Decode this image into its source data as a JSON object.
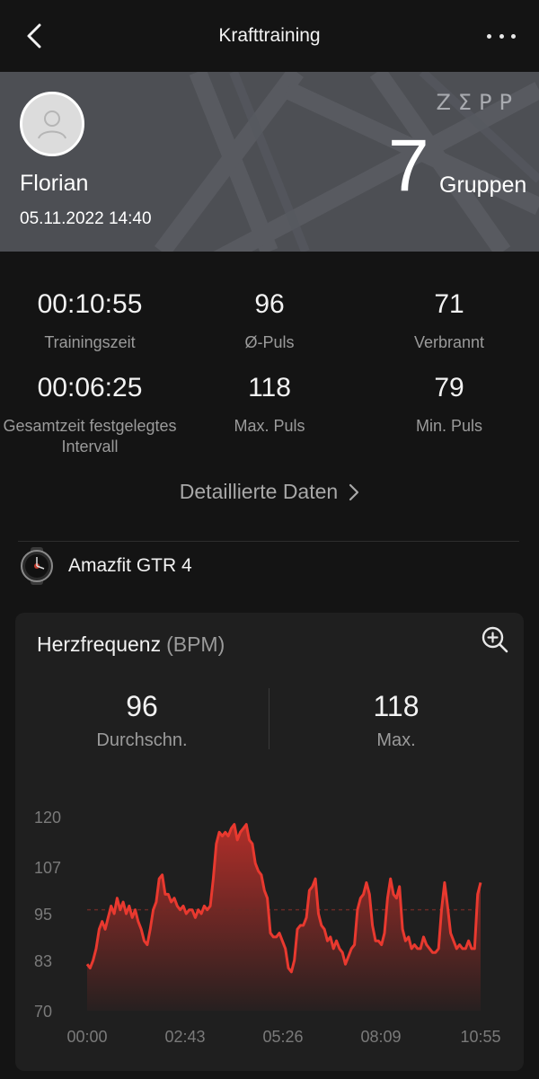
{
  "header": {
    "title": "Krafttraining"
  },
  "profile": {
    "name": "Florian",
    "datetime": "05.11.2022 14:40",
    "brand": "ZΣPP",
    "groups_count": "7",
    "groups_label": "Gruppen"
  },
  "stats": [
    {
      "value": "00:10:55",
      "label": "Trainingszeit"
    },
    {
      "value": "96",
      "label": "Ø-Puls"
    },
    {
      "value": "71",
      "label": "Verbrannt"
    },
    {
      "value": "00:06:25",
      "label": "Gesamtzeit festgelegtes Intervall"
    },
    {
      "value": "118",
      "label": "Max. Puls"
    },
    {
      "value": "79",
      "label": "Min. Puls"
    }
  ],
  "details_link": "Detaillierte Daten",
  "device": {
    "name": "Amazfit GTR 4"
  },
  "heart_card": {
    "title": "Herzfrequenz",
    "unit": "(BPM)",
    "avg_value": "96",
    "avg_label": "Durchschn.",
    "max_value": "118",
    "max_label": "Max."
  },
  "chart_data": {
    "type": "area",
    "title": "Herzfrequenz (BPM)",
    "xlabel": "",
    "ylabel": "",
    "x_ticks": [
      "00:00",
      "02:43",
      "05:26",
      "08:09",
      "10:55"
    ],
    "y_ticks": [
      120,
      107,
      95,
      83,
      70
    ],
    "ylim": [
      70,
      120
    ],
    "xlim_seconds": [
      0,
      655
    ],
    "avg_line": 96,
    "grid": false,
    "color": "#e8392f",
    "series": [
      {
        "x": [
          0,
          5,
          10,
          15,
          20,
          25,
          30,
          35,
          40,
          45,
          50,
          55,
          60,
          65,
          70,
          75,
          80,
          85,
          90,
          95,
          100,
          105,
          110,
          115,
          120,
          125,
          130,
          135,
          140,
          145,
          150,
          155,
          160,
          165,
          170,
          175,
          180,
          185,
          190,
          195,
          200,
          205,
          210,
          215,
          220,
          225,
          230,
          235,
          240,
          245,
          250,
          255,
          260,
          265,
          270,
          275,
          280,
          285,
          290,
          295,
          300,
          305,
          310,
          315,
          320,
          325,
          330,
          335,
          340,
          345,
          350,
          355,
          360,
          365,
          370,
          375,
          380,
          385,
          390,
          395,
          400,
          405,
          410,
          415,
          420,
          425,
          430,
          435,
          440,
          445,
          450,
          455,
          460,
          465,
          470,
          475,
          480,
          485,
          490,
          495,
          500,
          505,
          510,
          515,
          520,
          525,
          530,
          535,
          540,
          545,
          550,
          555,
          560,
          565,
          570,
          575,
          580,
          585,
          590,
          595,
          600,
          605,
          610,
          615,
          620,
          625,
          630,
          635,
          640,
          645,
          650,
          655
        ],
        "values": [
          82,
          81,
          83,
          86,
          91,
          93,
          91,
          94,
          97,
          95,
          99,
          96,
          98,
          95,
          97,
          94,
          96,
          93,
          91,
          88,
          87,
          91,
          96,
          98,
          104,
          105,
          100,
          100,
          98,
          99,
          97,
          96,
          97,
          95,
          96,
          96,
          94,
          96,
          95,
          97,
          96,
          97,
          104,
          113,
          116,
          115,
          116,
          115,
          117,
          118,
          114,
          116,
          117,
          118,
          114,
          113,
          108,
          106,
          105,
          101,
          99,
          90,
          89,
          89,
          90,
          88,
          86,
          81,
          80,
          83,
          91,
          92,
          92,
          94,
          101,
          102,
          104,
          95,
          92,
          91,
          88,
          89,
          86,
          88,
          86,
          85,
          82,
          84,
          86,
          87,
          96,
          99,
          100,
          103,
          100,
          92,
          88,
          88,
          87,
          90,
          99,
          104,
          100,
          99,
          102,
          91,
          88,
          89,
          86,
          87,
          86,
          86,
          89,
          87,
          86,
          85,
          85,
          86,
          96,
          103,
          97,
          90,
          88,
          86,
          87,
          86,
          86,
          88,
          86,
          86,
          100,
          103
        ]
      }
    ]
  }
}
